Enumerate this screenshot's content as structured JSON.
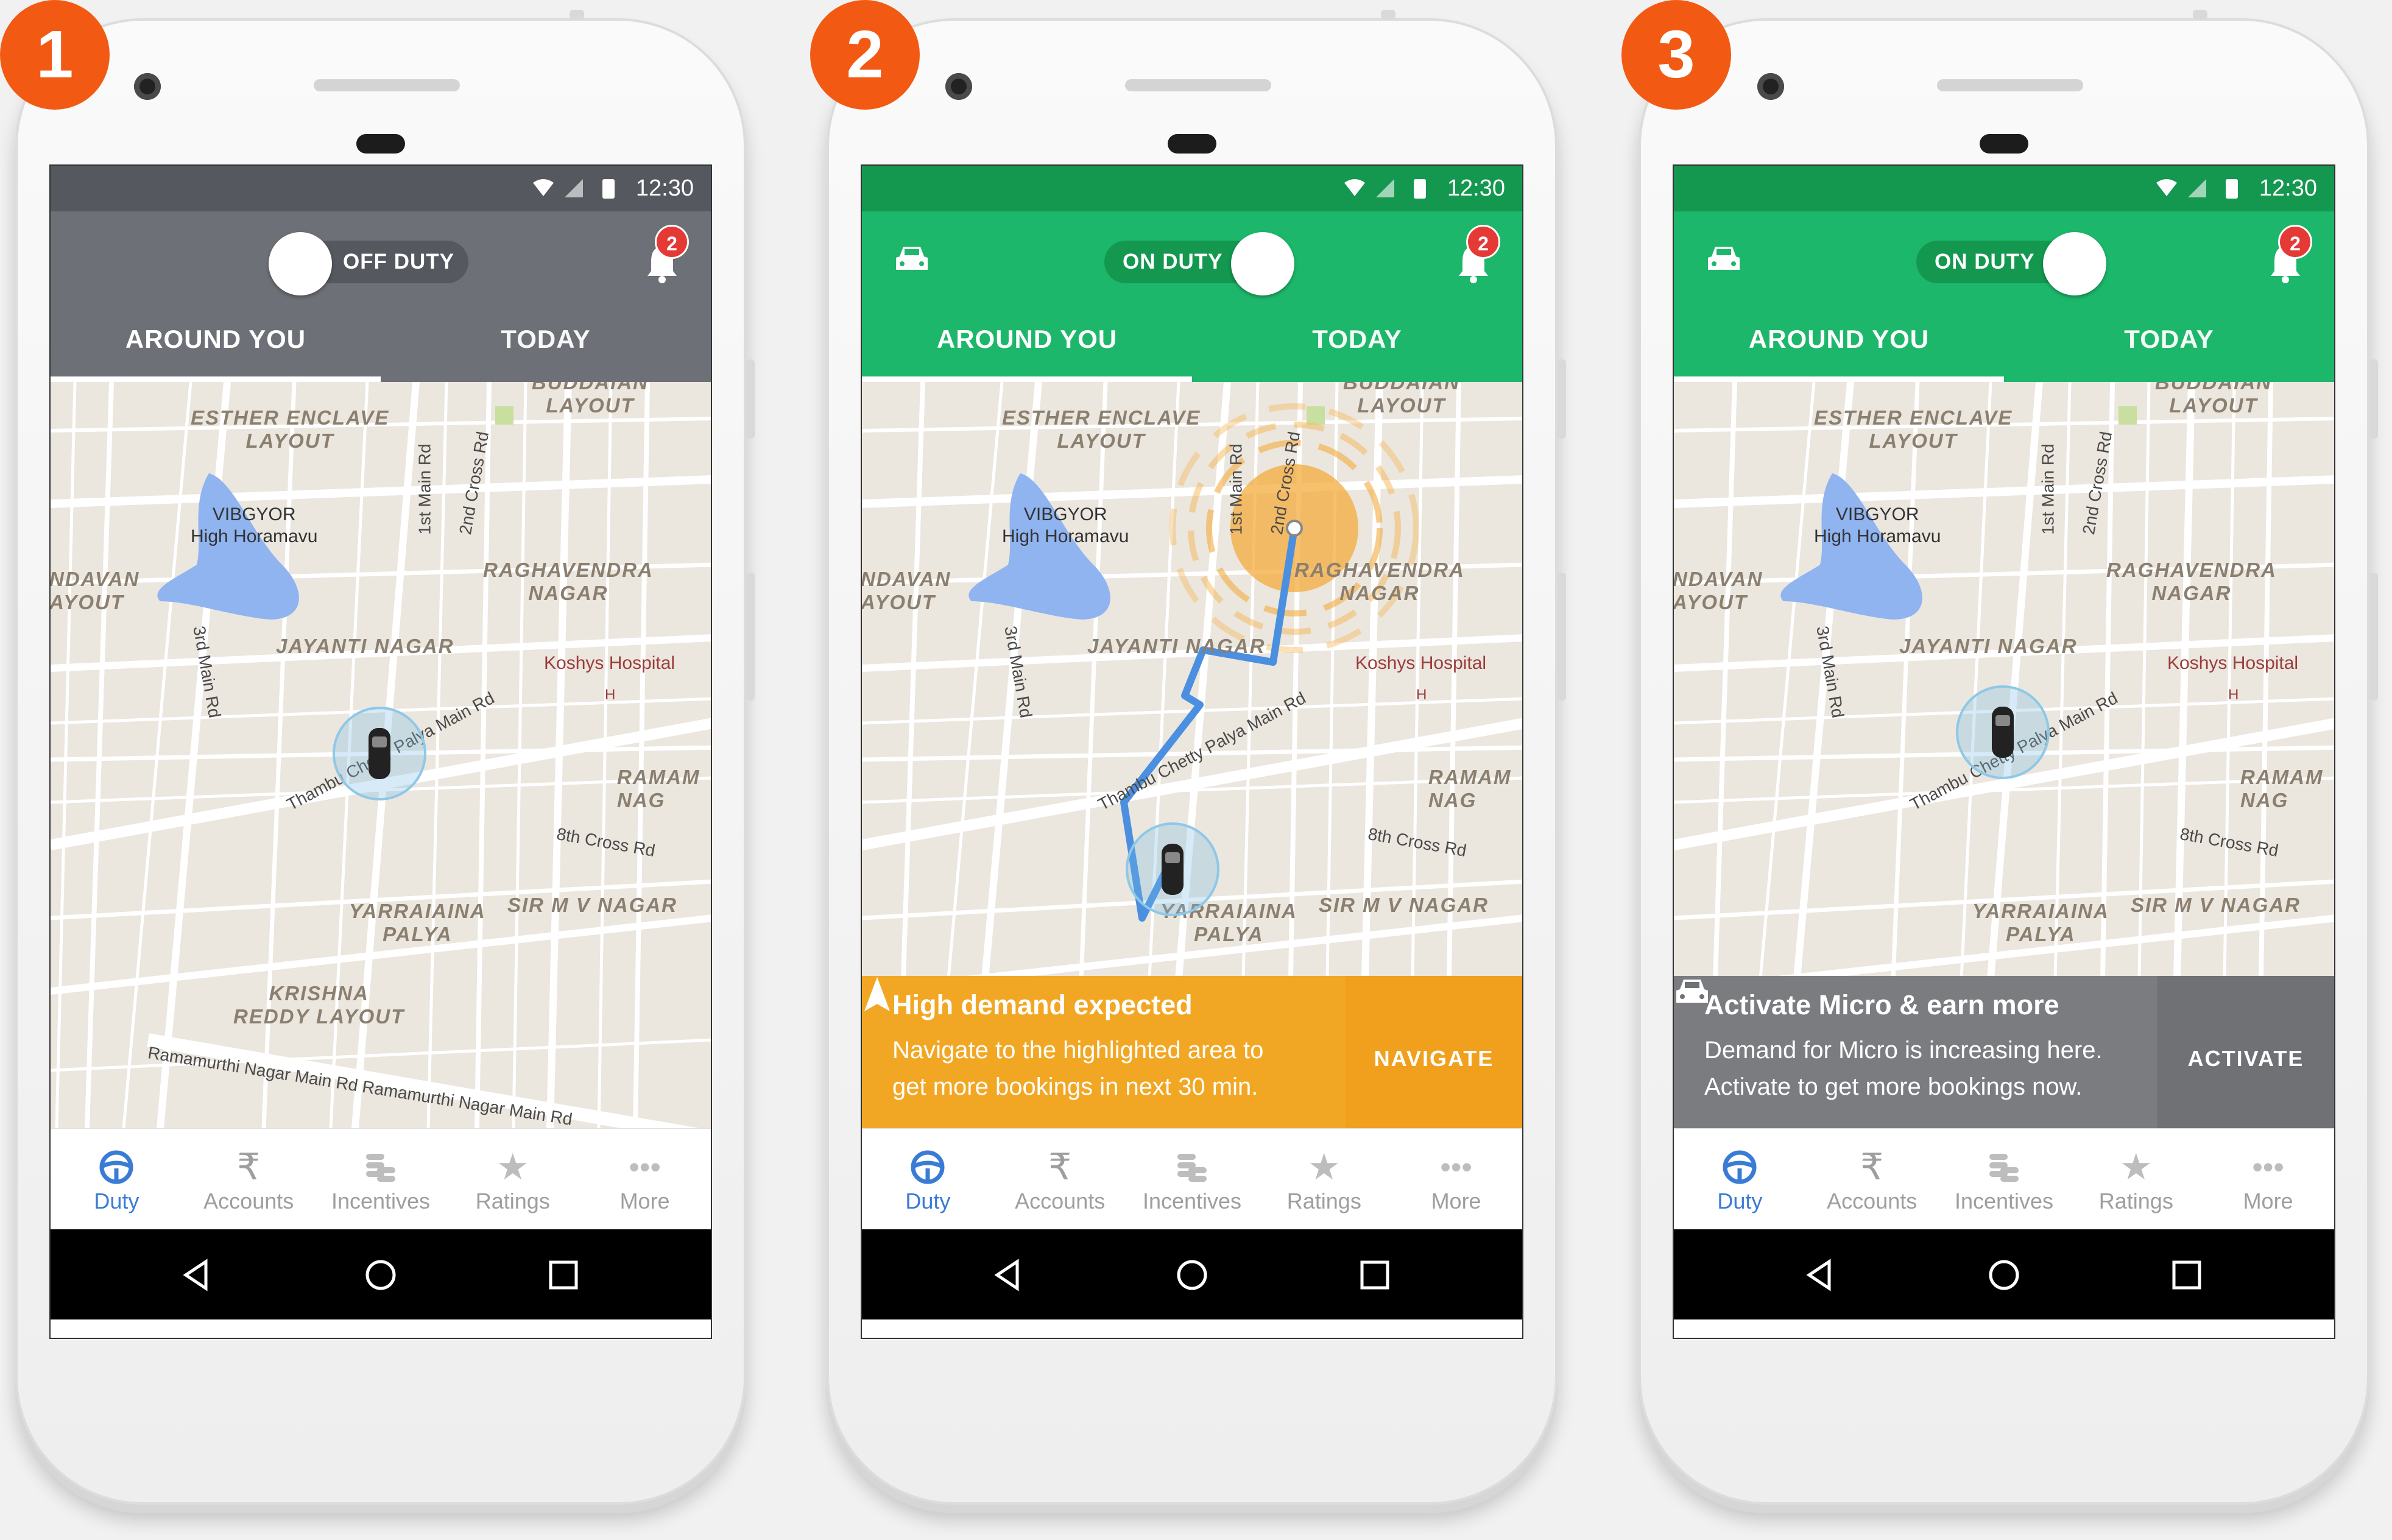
{
  "colors": {
    "badge": "#f25a14",
    "off_duty_bar": "#6d7076",
    "off_duty_status": "#55585e",
    "on_duty_bar": "#1db76b",
    "on_duty_status": "#14974f",
    "demand_orange": "#f2a724",
    "micro_gray": "#7a7c80",
    "nav_active": "#3a7bd5",
    "route_blue": "#4a8fe0"
  },
  "screens": [
    {
      "step": "1",
      "status_time": "12:30",
      "duty_label": "OFF DUTY",
      "notification_count": "2",
      "tabs": [
        "AROUND YOU",
        "TODAY"
      ],
      "nav": [
        "Duty",
        "Accounts",
        "Incentives",
        "Ratings",
        "More"
      ]
    },
    {
      "step": "2",
      "status_time": "12:30",
      "duty_label": "ON DUTY",
      "notification_count": "2",
      "tabs": [
        "AROUND YOU",
        "TODAY"
      ],
      "banner": {
        "title": "High demand expected",
        "desc_line1": "Navigate to the highlighted area to",
        "desc_line2": "get more bookings in next 30 min.",
        "action": "NAVIGATE"
      },
      "nav": [
        "Duty",
        "Accounts",
        "Incentives",
        "Ratings",
        "More"
      ]
    },
    {
      "step": "3",
      "status_time": "12:30",
      "duty_label": "ON DUTY",
      "notification_count": "2",
      "tabs": [
        "AROUND YOU",
        "TODAY"
      ],
      "banner": {
        "title": "Activate Micro & earn more",
        "desc_line1": "Demand for Micro is increasing here.",
        "desc_line2": "Activate to get more bookings now.",
        "action": "ACTIVATE"
      },
      "nav": [
        "Duty",
        "Accounts",
        "Incentives",
        "Ratings",
        "More"
      ]
    }
  ],
  "map_labels": {
    "area_esther_1": "ESTHER ENCLAVE",
    "area_esther_2": "LAYOUT",
    "area_budhan_1": "BUDDAIAN",
    "area_budhan_2": "LAYOUT",
    "area_ndavan_1": "NDAVAN",
    "area_ndavan_2": "AYOUT",
    "area_ragh_1": "RAGHAVENDRA",
    "area_ragh_2": "NAGAR",
    "area_jayanti": "JAYANTI NAGAR",
    "area_ramam_1": "RAMAM",
    "area_ramam_2": "NAG",
    "area_yarr_1": "YARRAIAINA",
    "area_yarr_2": "PALYA",
    "area_sirmv": "SIR M V NAGAR",
    "area_krishna_1": "KRISHNA",
    "area_krishna_2": "REDDY LAYOUT",
    "poi_vibgyor_1": "VIBGYOR",
    "poi_vibgyor_2": "High Horamavu",
    "poi_koshys": "Koshys Hospital",
    "road_1stmain": "1st Main Rd",
    "road_2ndcross": "2nd Cross Rd",
    "road_3rdmain": "3rd Main Rd",
    "road_thambu": "Thambu Chetty Palya Main Rd",
    "road_8thcross": "8th Cross Rd",
    "road_ramamurthi": "Ramamurthi Nagar Main Rd Ramamurthi Nagar Main Rd",
    "hospital_marker": "H"
  }
}
